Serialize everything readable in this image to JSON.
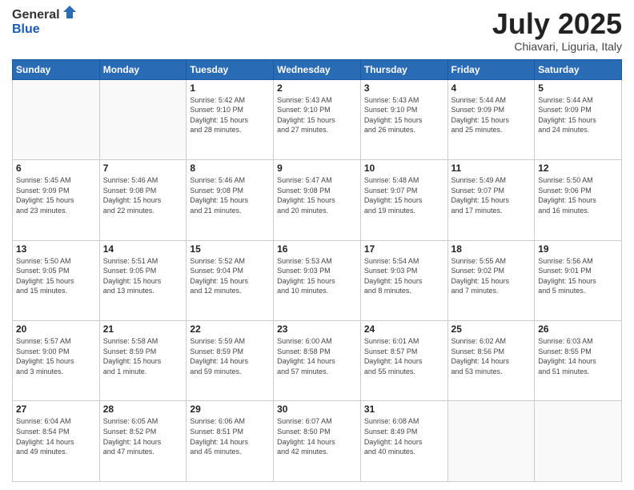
{
  "logo": {
    "general": "General",
    "blue": "Blue"
  },
  "header": {
    "month": "July 2025",
    "location": "Chiavari, Liguria, Italy"
  },
  "weekdays": [
    "Sunday",
    "Monday",
    "Tuesday",
    "Wednesday",
    "Thursday",
    "Friday",
    "Saturday"
  ],
  "weeks": [
    [
      {
        "day": "",
        "info": ""
      },
      {
        "day": "",
        "info": ""
      },
      {
        "day": "1",
        "info": "Sunrise: 5:42 AM\nSunset: 9:10 PM\nDaylight: 15 hours\nand 28 minutes."
      },
      {
        "day": "2",
        "info": "Sunrise: 5:43 AM\nSunset: 9:10 PM\nDaylight: 15 hours\nand 27 minutes."
      },
      {
        "day": "3",
        "info": "Sunrise: 5:43 AM\nSunset: 9:10 PM\nDaylight: 15 hours\nand 26 minutes."
      },
      {
        "day": "4",
        "info": "Sunrise: 5:44 AM\nSunset: 9:09 PM\nDaylight: 15 hours\nand 25 minutes."
      },
      {
        "day": "5",
        "info": "Sunrise: 5:44 AM\nSunset: 9:09 PM\nDaylight: 15 hours\nand 24 minutes."
      }
    ],
    [
      {
        "day": "6",
        "info": "Sunrise: 5:45 AM\nSunset: 9:09 PM\nDaylight: 15 hours\nand 23 minutes."
      },
      {
        "day": "7",
        "info": "Sunrise: 5:46 AM\nSunset: 9:08 PM\nDaylight: 15 hours\nand 22 minutes."
      },
      {
        "day": "8",
        "info": "Sunrise: 5:46 AM\nSunset: 9:08 PM\nDaylight: 15 hours\nand 21 minutes."
      },
      {
        "day": "9",
        "info": "Sunrise: 5:47 AM\nSunset: 9:08 PM\nDaylight: 15 hours\nand 20 minutes."
      },
      {
        "day": "10",
        "info": "Sunrise: 5:48 AM\nSunset: 9:07 PM\nDaylight: 15 hours\nand 19 minutes."
      },
      {
        "day": "11",
        "info": "Sunrise: 5:49 AM\nSunset: 9:07 PM\nDaylight: 15 hours\nand 17 minutes."
      },
      {
        "day": "12",
        "info": "Sunrise: 5:50 AM\nSunset: 9:06 PM\nDaylight: 15 hours\nand 16 minutes."
      }
    ],
    [
      {
        "day": "13",
        "info": "Sunrise: 5:50 AM\nSunset: 9:05 PM\nDaylight: 15 hours\nand 15 minutes."
      },
      {
        "day": "14",
        "info": "Sunrise: 5:51 AM\nSunset: 9:05 PM\nDaylight: 15 hours\nand 13 minutes."
      },
      {
        "day": "15",
        "info": "Sunrise: 5:52 AM\nSunset: 9:04 PM\nDaylight: 15 hours\nand 12 minutes."
      },
      {
        "day": "16",
        "info": "Sunrise: 5:53 AM\nSunset: 9:03 PM\nDaylight: 15 hours\nand 10 minutes."
      },
      {
        "day": "17",
        "info": "Sunrise: 5:54 AM\nSunset: 9:03 PM\nDaylight: 15 hours\nand 8 minutes."
      },
      {
        "day": "18",
        "info": "Sunrise: 5:55 AM\nSunset: 9:02 PM\nDaylight: 15 hours\nand 7 minutes."
      },
      {
        "day": "19",
        "info": "Sunrise: 5:56 AM\nSunset: 9:01 PM\nDaylight: 15 hours\nand 5 minutes."
      }
    ],
    [
      {
        "day": "20",
        "info": "Sunrise: 5:57 AM\nSunset: 9:00 PM\nDaylight: 15 hours\nand 3 minutes."
      },
      {
        "day": "21",
        "info": "Sunrise: 5:58 AM\nSunset: 8:59 PM\nDaylight: 15 hours\nand 1 minute."
      },
      {
        "day": "22",
        "info": "Sunrise: 5:59 AM\nSunset: 8:59 PM\nDaylight: 14 hours\nand 59 minutes."
      },
      {
        "day": "23",
        "info": "Sunrise: 6:00 AM\nSunset: 8:58 PM\nDaylight: 14 hours\nand 57 minutes."
      },
      {
        "day": "24",
        "info": "Sunrise: 6:01 AM\nSunset: 8:57 PM\nDaylight: 14 hours\nand 55 minutes."
      },
      {
        "day": "25",
        "info": "Sunrise: 6:02 AM\nSunset: 8:56 PM\nDaylight: 14 hours\nand 53 minutes."
      },
      {
        "day": "26",
        "info": "Sunrise: 6:03 AM\nSunset: 8:55 PM\nDaylight: 14 hours\nand 51 minutes."
      }
    ],
    [
      {
        "day": "27",
        "info": "Sunrise: 6:04 AM\nSunset: 8:54 PM\nDaylight: 14 hours\nand 49 minutes."
      },
      {
        "day": "28",
        "info": "Sunrise: 6:05 AM\nSunset: 8:52 PM\nDaylight: 14 hours\nand 47 minutes."
      },
      {
        "day": "29",
        "info": "Sunrise: 6:06 AM\nSunset: 8:51 PM\nDaylight: 14 hours\nand 45 minutes."
      },
      {
        "day": "30",
        "info": "Sunrise: 6:07 AM\nSunset: 8:50 PM\nDaylight: 14 hours\nand 42 minutes."
      },
      {
        "day": "31",
        "info": "Sunrise: 6:08 AM\nSunset: 8:49 PM\nDaylight: 14 hours\nand 40 minutes."
      },
      {
        "day": "",
        "info": ""
      },
      {
        "day": "",
        "info": ""
      }
    ]
  ]
}
